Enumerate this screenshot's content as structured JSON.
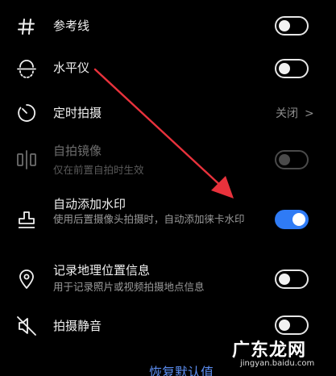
{
  "settings": {
    "gridlines": {
      "title": "参考线",
      "icon": "grid-icon",
      "state": "off"
    },
    "level": {
      "title": "水平仪",
      "icon": "level-icon",
      "state": "off"
    },
    "timer": {
      "title": "定时拍摄",
      "icon": "timer-icon",
      "value": "关闭",
      "chevron": ">"
    },
    "mirror": {
      "title": "自拍镜像",
      "subtitle": "仅在前置自拍时生效",
      "icon": "mirror-icon",
      "state": "disabled-off"
    },
    "watermark": {
      "title": "自动添加水印",
      "subtitle": "使用后置摄像头拍摄时，自动添加徕卡水印",
      "icon": "stamp-icon",
      "state": "on"
    },
    "location": {
      "title": "记录地理位置信息",
      "subtitle": "用于记录照片或视频拍摄地点信息",
      "icon": "location-pin-icon",
      "state": "off"
    },
    "mute": {
      "title": "拍摄静音",
      "icon": "mute-speaker-icon",
      "state": "off"
    }
  },
  "bottom_button": {
    "label": "恢复默认值"
  },
  "watermark_overlay": {
    "text": "广东龙网",
    "subtext": "jingyan.baidu.com"
  },
  "colors": {
    "background": "#000000",
    "accent": "#2f7bf5",
    "annotation_arrow": "#e8323c"
  }
}
